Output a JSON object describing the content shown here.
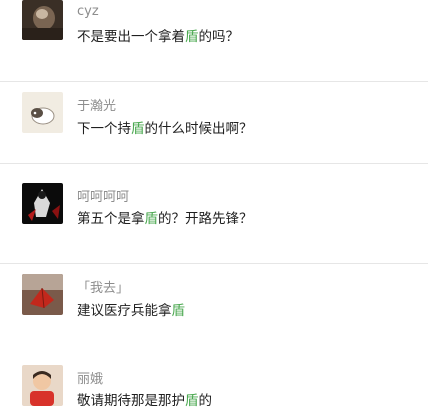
{
  "comments": [
    {
      "name": "cyz",
      "text_before": "不是要出一个拿着",
      "highlight": "盾",
      "text_after": "的吗？",
      "avatar": "dark-portrait-avatar"
    },
    {
      "name": "于瀚光",
      "text_before": "下一个持",
      "highlight": "盾",
      "text_after": "的什么时候出啊？",
      "avatar": "cat-avatar"
    },
    {
      "name": "呵呵呵呵",
      "text_before": "第五个是拿",
      "highlight": "盾",
      "text_after": "的？开路先锋？",
      "avatar": "black-figure-avatar"
    },
    {
      "name": "「我去」",
      "text_before": "建议医疗兵能拿",
      "highlight": "盾",
      "text_after": "",
      "avatar": "red-leaf-avatar"
    },
    {
      "name": "丽娥",
      "text_before": "敬请期待那是那护",
      "highlight": "盾",
      "text_after": "的",
      "avatar": "child-avatar"
    }
  ],
  "colors": {
    "highlight": "#4aa84f",
    "name": "#8d8d8d",
    "text": "#1f1f1f",
    "divider": "#e6e6e6"
  }
}
